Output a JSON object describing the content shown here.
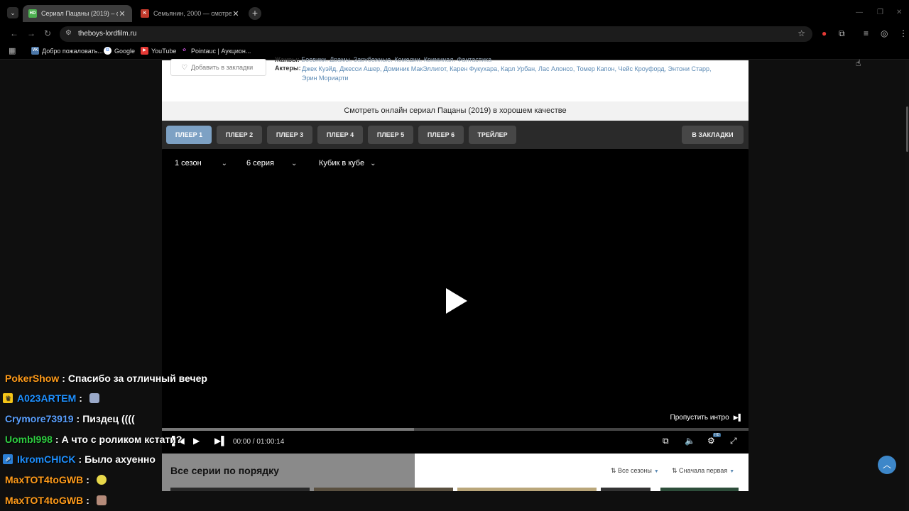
{
  "browser": {
    "tabs": [
      {
        "title": "Сериал Пацаны (2019) – смотр",
        "favicon": "HD",
        "favicon_color": "#4caf50",
        "active": true
      },
      {
        "title": "Семьянин, 2000 — смотреть о",
        "favicon": "K",
        "favicon_color": "#c0392b",
        "active": false
      }
    ],
    "url": "theboys-lordfilm.ru",
    "bookmarks": [
      {
        "label": "Добро пожаловать...",
        "icon": "vk-icon",
        "color": "#4a76a8",
        "glyph": "VK"
      },
      {
        "label": "Google",
        "icon": "google-icon",
        "color": "#ffffff",
        "glyph": "G"
      },
      {
        "label": "YouTube",
        "icon": "youtube-icon",
        "color": "#e53935",
        "glyph": "▶"
      },
      {
        "label": "Pointauc | Аукцион...",
        "icon": "pointauc-icon",
        "color": "#9c27b0",
        "glyph": "✿"
      }
    ]
  },
  "page": {
    "bookmark_button": "Добавить в закладки",
    "genres_label": "Жанры:",
    "genres": "Боевики, Драмы, Зарубежные, Комедии, Криминал, Фантастика",
    "actors_label": "Актеры:",
    "actors": "Джек Куэйд, Джесси Ашер, Доминик МакЭллигот, Карен Фукухара, Карл Урбан, Лас Алонсо, Томер Капон, Чейс Кроуфорд, Энтони Старр, Эрин Мориарти",
    "watch_title": "Смотреть онлайн сериал Пацаны (2019) в хорошем качестве",
    "player_tabs": [
      "ПЛЕЕР 1",
      "ПЛЕЕР 2",
      "ПЛЕЕР 3",
      "ПЛЕЕР 4",
      "ПЛЕЕР 5",
      "ПЛЕЕР 6",
      "ТРЕЙЛЕР"
    ],
    "bookmarks_button": "В ЗАКЛАДКИ"
  },
  "player": {
    "season": "1 сезон",
    "episode": "6 серия",
    "translation": "Кубик в кубе",
    "skip_intro": "Пропустить интро",
    "time": "00:00 / 01:00:14",
    "progress_buffered": 0.43,
    "quality_badge": "HD"
  },
  "series": {
    "title": "Все серии по порядку",
    "filter_seasons": "Все сезоны",
    "filter_order": "Сначала первая"
  },
  "chat": [
    {
      "user": "PokerShow",
      "color": "#ff9b1a",
      "message": "Спасибо за отличный вечер",
      "badge": null,
      "emote": null
    },
    {
      "user": "A023ARTEM",
      "color": "#1e90ff",
      "message": "",
      "badge": "crown",
      "badge_color": "#f5c518",
      "emote": "#9aa9c9"
    },
    {
      "user": "Crymore73919",
      "color": "#5aa0ff",
      "message": "Пиздец ((((",
      "badge": null,
      "emote": null
    },
    {
      "user": "Uombl998",
      "color": "#2ecc40",
      "message": "А что с роликом кстати?",
      "badge": null,
      "emote": null
    },
    {
      "user": "IkromCHICK",
      "color": "#1e90ff",
      "message": "Было ахуенно",
      "badge": "prime",
      "badge_color": "#2b7fd6",
      "emote": null
    },
    {
      "user": "MaxTOT4toGWB",
      "color": "#ff9b1a",
      "message": "",
      "badge": null,
      "emote": "#e8d84a"
    },
    {
      "user": "MaxTOT4toGWB",
      "color": "#ff9b1a",
      "message": "",
      "badge": null,
      "emote": "#b58b7a"
    }
  ]
}
